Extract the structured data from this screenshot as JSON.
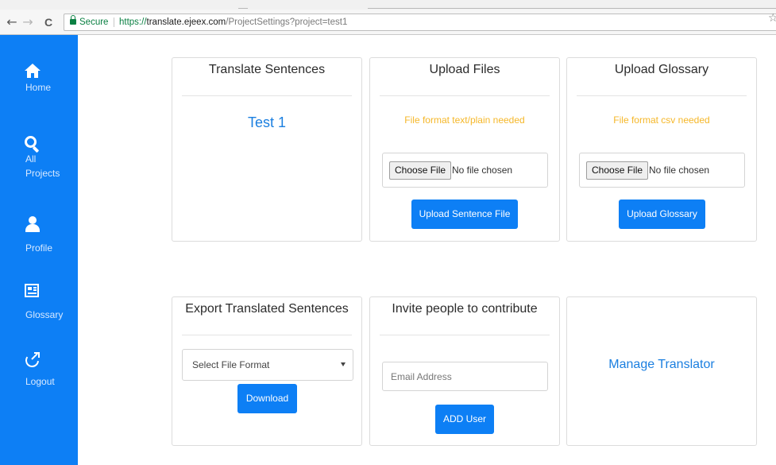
{
  "browser": {
    "secure_label": "Secure",
    "url_scheme": "https://",
    "url_host": "translate.ejeex.com",
    "url_path": "/ProjectSettings?project=test1",
    "back_glyph": "←",
    "forward_glyph": "→",
    "reload_glyph": "C",
    "star_glyph": "☆"
  },
  "sidebar": {
    "color": "#0d7ff5",
    "items": [
      {
        "label": "Home",
        "icon": "home-icon"
      },
      {
        "label": "All",
        "label2": "Projects",
        "icon": "search-icon"
      },
      {
        "label": "Profile",
        "icon": "user-icon"
      },
      {
        "label": "Glossary",
        "icon": "newspaper-icon"
      },
      {
        "label": "Logout",
        "icon": "logout-icon"
      }
    ]
  },
  "cards": {
    "translate": {
      "title": "Translate Sentences",
      "project_link": "Test 1"
    },
    "upload_files": {
      "title": "Upload Files",
      "hint": "File format text/plain needed",
      "choose_label": "Choose File",
      "no_file": "No file chosen",
      "button": "Upload Sentence File"
    },
    "upload_glossary": {
      "title": "Upload Glossary",
      "hint": "File format csv needed",
      "choose_label": "Choose File",
      "no_file": "No file chosen",
      "button": "Upload Glossary"
    },
    "export": {
      "title": "Export Translated Sentences",
      "select_value": "Select File Format",
      "button": "Download"
    },
    "invite": {
      "title": "Invite people to contribute",
      "email_placeholder": "Email Address",
      "button": "ADD User"
    },
    "manage": {
      "link": "Manage Translator"
    }
  },
  "colors": {
    "primary": "#0d7ff5",
    "hint": "#f5b729",
    "link": "#1b7fe0"
  }
}
